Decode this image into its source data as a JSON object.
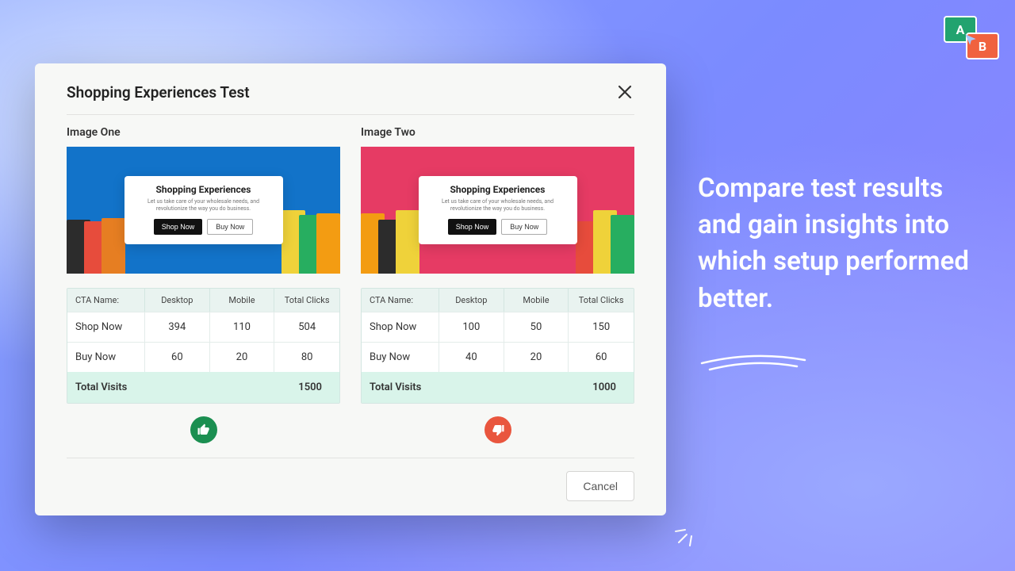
{
  "tagline": "Compare test results and gain insights into which setup performed better.",
  "dialog": {
    "title": "Shopping Experiences Test",
    "cancel_label": "Cancel"
  },
  "overlay": {
    "title": "Shopping Experiences",
    "subtitle": "Let us take care of your wholesale needs, and revolutionize the way you do business.",
    "shop_now": "Shop Now",
    "buy_now": "Buy Now"
  },
  "table_headers": {
    "cta": "CTA Name:",
    "desktop": "Desktop",
    "mobile": "Mobile",
    "total": "Total Clicks"
  },
  "variants": [
    {
      "label": "Image One",
      "bg": "blue",
      "verdict": "up",
      "rows": [
        {
          "cta": "Shop Now",
          "desktop": "394",
          "mobile": "110",
          "total": "504"
        },
        {
          "cta": "Buy Now",
          "desktop": "60",
          "mobile": "20",
          "total": "80"
        }
      ],
      "total_visits_label": "Total Visits",
      "total_visits_value": "1500"
    },
    {
      "label": "Image Two",
      "bg": "pink",
      "verdict": "down",
      "rows": [
        {
          "cta": "Shop Now",
          "desktop": "100",
          "mobile": "50",
          "total": "150"
        },
        {
          "cta": "Buy Now",
          "desktop": "40",
          "mobile": "20",
          "total": "60"
        }
      ],
      "total_visits_label": "Total Visits",
      "total_visits_value": "1000"
    }
  ],
  "chart_data": {
    "type": "table",
    "title": "Shopping Experiences Test",
    "variants": [
      {
        "name": "Image One",
        "cta_clicks": [
          {
            "cta": "Shop Now",
            "desktop": 394,
            "mobile": 110,
            "total": 504
          },
          {
            "cta": "Buy Now",
            "desktop": 60,
            "mobile": 20,
            "total": 80
          }
        ],
        "total_visits": 1500,
        "winner": true
      },
      {
        "name": "Image Two",
        "cta_clicks": [
          {
            "cta": "Shop Now",
            "desktop": 100,
            "mobile": 50,
            "total": 150
          },
          {
            "cta": "Buy Now",
            "desktop": 40,
            "mobile": 20,
            "total": 60
          }
        ],
        "total_visits": 1000,
        "winner": false
      }
    ]
  }
}
